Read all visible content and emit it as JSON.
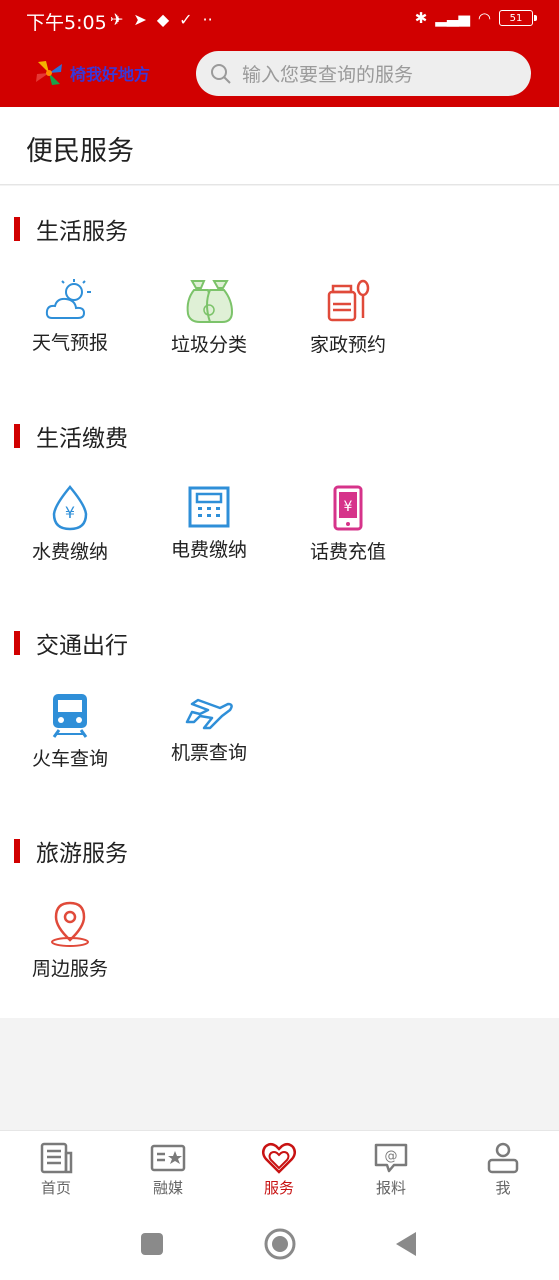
{
  "status_bar": {
    "time": "下午5:05",
    "battery": "51"
  },
  "header": {
    "logo_text": "椅我好地方",
    "search_placeholder": "输入您要查询的服务"
  },
  "page": {
    "title": "便民服务"
  },
  "sections": [
    {
      "title": "生活服务",
      "items": [
        {
          "label": "天气预报",
          "icon": "weather-icon"
        },
        {
          "label": "垃圾分类",
          "icon": "garbage-bags-icon"
        },
        {
          "label": "家政预约",
          "icon": "housekeeping-icon"
        }
      ]
    },
    {
      "title": "生活缴费",
      "items": [
        {
          "label": "水费缴纳",
          "icon": "water-drop-icon"
        },
        {
          "label": "电费缴纳",
          "icon": "electric-meter-icon"
        },
        {
          "label": "话费充值",
          "icon": "phone-recharge-icon"
        }
      ]
    },
    {
      "title": "交通出行",
      "items": [
        {
          "label": "火车查询",
          "icon": "train-icon"
        },
        {
          "label": "机票查询",
          "icon": "airplane-icon"
        }
      ]
    },
    {
      "title": "旅游服务",
      "items": [
        {
          "label": "周边服务",
          "icon": "location-pin-icon"
        }
      ]
    }
  ],
  "tabs": [
    {
      "label": "首页",
      "icon": "news-icon"
    },
    {
      "label": "融媒",
      "icon": "media-card-icon"
    },
    {
      "label": "服务",
      "icon": "heart-icon",
      "active": true
    },
    {
      "label": "报料",
      "icon": "report-bubble-icon"
    },
    {
      "label": "我",
      "icon": "user-icon"
    }
  ],
  "colors": {
    "brand": "#d10000",
    "active_tab": "#c81313",
    "blue": "#2f8fd8",
    "green": "#7cc36a",
    "pink": "#d6338a"
  }
}
